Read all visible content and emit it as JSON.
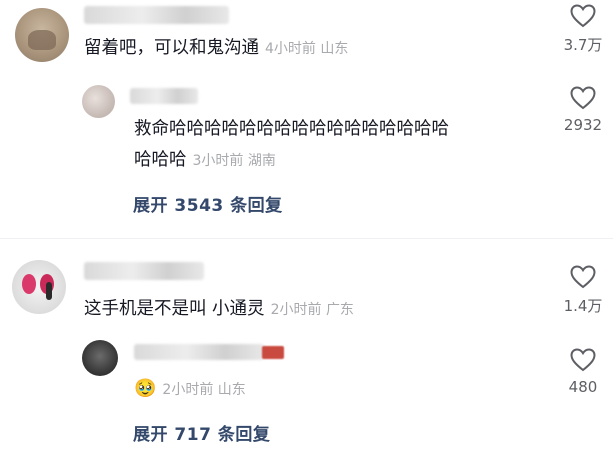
{
  "comments": [
    {
      "text": "留着吧，可以和鬼沟通",
      "time": "4小时前",
      "location": "山东",
      "likes": "3.7万",
      "reply": {
        "text_line1": "救命哈哈哈哈哈哈哈哈哈哈哈哈哈哈哈哈",
        "text_line2": "哈哈哈",
        "time": "3小时前",
        "location": "湖南",
        "likes": "2932"
      },
      "expand_label": "展开 3543 条回复"
    },
    {
      "text": "这手机是不是叫 小通灵",
      "time": "2小时前",
      "location": "广东",
      "likes": "1.4万",
      "reply": {
        "emoji": "🥹",
        "time": "2小时前",
        "location": "山东",
        "likes": "480"
      },
      "expand_label": "展开 717 条回复"
    }
  ],
  "icons": {
    "like": "heart-outline-icon",
    "emoji": "crying-face-emoji"
  },
  "colors": {
    "text": "#161823",
    "meta": "#a9aaae",
    "expand": "#33486b"
  }
}
